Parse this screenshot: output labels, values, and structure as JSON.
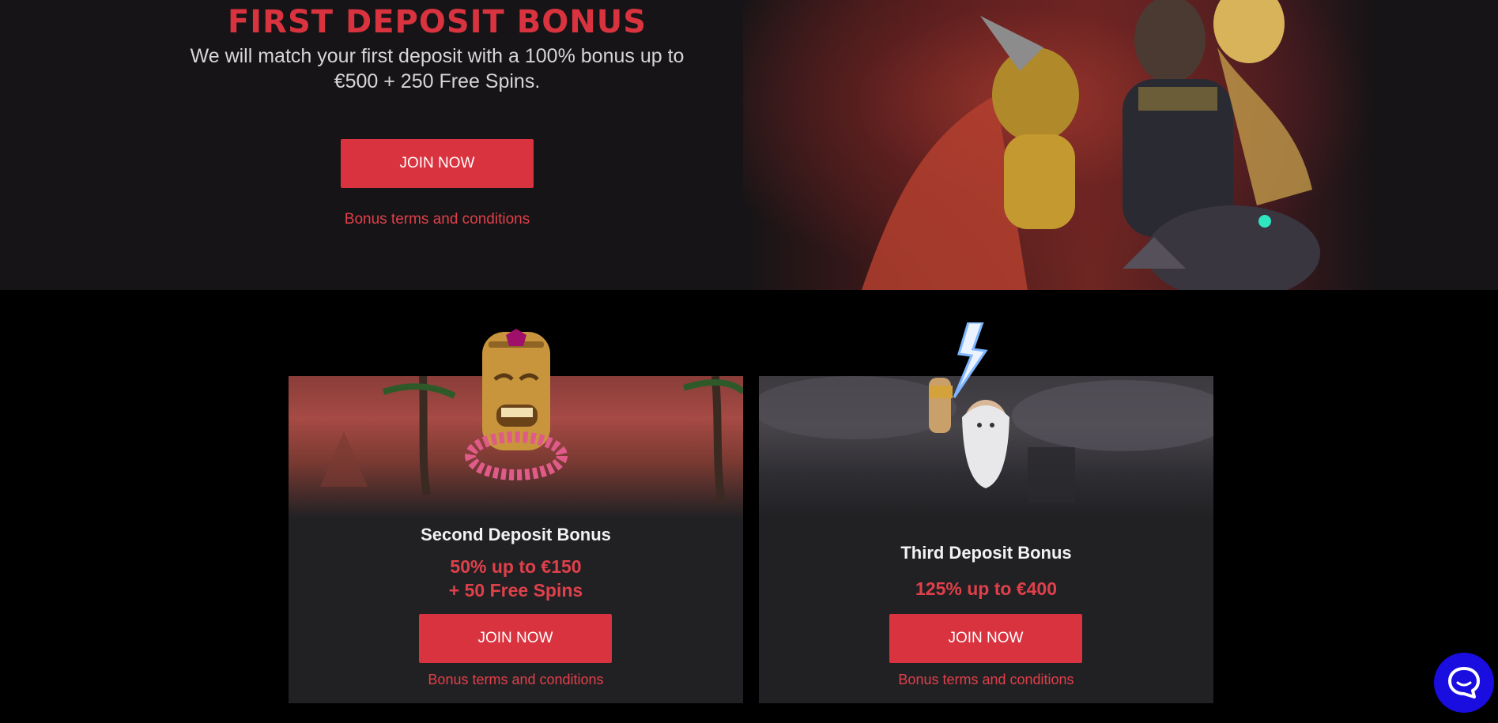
{
  "hero": {
    "title": "FIRST DEPOSIT BONUS",
    "description": "We will match your first deposit with a 100% bonus up to €500 + 250 Free Spins.",
    "button_label": "JOIN NOW",
    "terms_link": "Bonus terms and conditions"
  },
  "cards": [
    {
      "title": "Second Deposit Bonus",
      "offer_line1": "50% up to €150",
      "offer_line2": "+ 50 Free Spins",
      "button_label": "JOIN NOW",
      "terms_link": "Bonus terms and conditions",
      "character_icon": "tiki-mask-icon"
    },
    {
      "title": "Third Deposit Bonus",
      "offer_line1": "125% up to €400",
      "button_label": "JOIN NOW",
      "terms_link": "Bonus terms and conditions",
      "character_icon": "zeus-lightning-icon"
    }
  ],
  "chat": {
    "icon": "chat-bubble-icon"
  },
  "colors": {
    "accent": "#d9333f",
    "hero_bg": "#161416",
    "page_bg": "#000000",
    "card_bg": "#212124",
    "chat_button": "#1a0de0"
  }
}
